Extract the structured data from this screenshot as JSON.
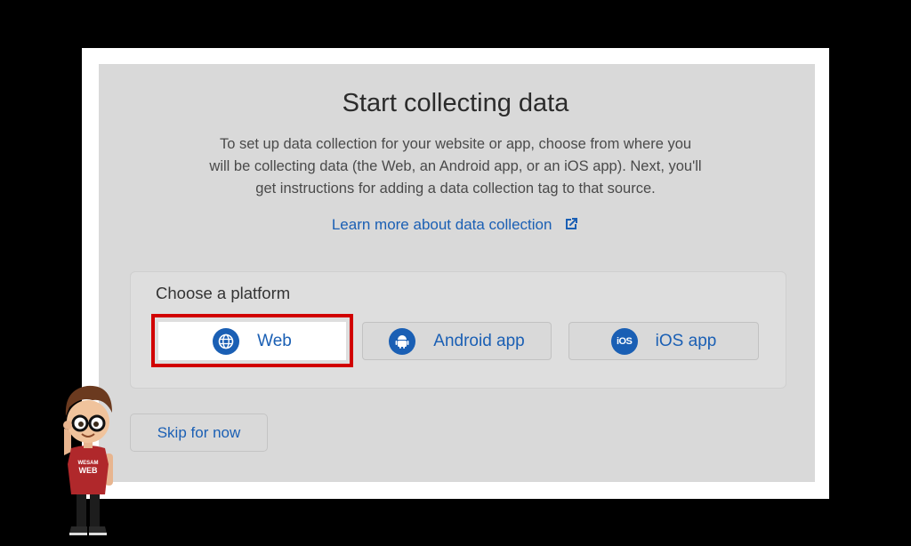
{
  "dialog": {
    "title": "Start collecting data",
    "description_lines": [
      "To set up data collection for your website or app, choose from where you",
      "will be collecting data (the Web, an Android app, or an iOS app). Next, you'll",
      "get instructions for adding a data collection tag to that source."
    ],
    "learn_more_link": "Learn more about data collection"
  },
  "platform": {
    "heading": "Choose a platform",
    "options": [
      {
        "label": "Web",
        "icon": "globe-icon"
      },
      {
        "label": "Android app",
        "icon": "android-icon"
      },
      {
        "label": "iOS app",
        "icon": "ios-icon",
        "icon_text": "iOS"
      }
    ]
  },
  "skip_label": "Skip for now",
  "mascot": {
    "shirt_text_1": "WESAM",
    "shirt_text_2": "WEB"
  },
  "colors": {
    "accent": "#1a5fb4",
    "highlight": "#d10000",
    "panel": "#d9d9d9",
    "background": "#000000"
  }
}
